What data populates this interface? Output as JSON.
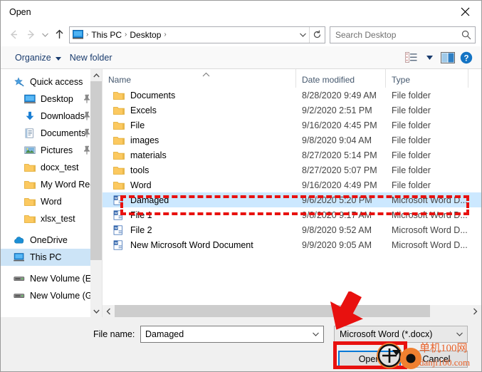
{
  "window": {
    "title": "Open",
    "close_icon": "close-icon"
  },
  "navigation": {
    "back_icon": "back-arrow-icon",
    "forward_icon": "forward-arrow-icon",
    "recent_icon": "recent-locations-chevron-icon",
    "up_icon": "up-arrow-icon",
    "address_icon": "this-pc-icon",
    "breadcrumbs": [
      "This PC",
      "Desktop"
    ],
    "separator": "›",
    "address_dropdown_icon": "chevron-down-icon",
    "refresh_icon": "refresh-icon"
  },
  "search": {
    "placeholder": "Search Desktop",
    "icon": "search-icon"
  },
  "command_bar": {
    "organize_label": "Organize",
    "organize_caret_icon": "caret-down-icon",
    "new_folder_label": "New folder",
    "view_icon": "view-options-icon",
    "view_caret_icon": "caret-down-icon",
    "preview_pane_icon": "preview-pane-icon",
    "help_icon": "help-icon"
  },
  "sidebar": {
    "items": [
      {
        "label": "Quick access",
        "icon": "quick-access-star-icon",
        "level": 0,
        "pinned": false,
        "selected": false
      },
      {
        "label": "Desktop",
        "icon": "desktop-monitor-icon",
        "level": 1,
        "pinned": true,
        "selected": false
      },
      {
        "label": "Downloads",
        "icon": "downloads-arrow-icon",
        "level": 1,
        "pinned": true,
        "selected": false
      },
      {
        "label": "Documents",
        "icon": "documents-icon",
        "level": 1,
        "pinned": true,
        "selected": false
      },
      {
        "label": "Pictures",
        "icon": "pictures-icon",
        "level": 1,
        "pinned": true,
        "selected": false
      },
      {
        "label": "docx_test",
        "icon": "folder-icon",
        "level": 1,
        "pinned": false,
        "selected": false
      },
      {
        "label": "My Word Recov",
        "icon": "folder-icon",
        "level": 1,
        "pinned": false,
        "selected": false
      },
      {
        "label": "Word",
        "icon": "folder-icon",
        "level": 1,
        "pinned": false,
        "selected": false
      },
      {
        "label": "xlsx_test",
        "icon": "folder-icon",
        "level": 1,
        "pinned": false,
        "selected": false
      },
      {
        "label": "OneDrive",
        "icon": "onedrive-cloud-icon",
        "level": 0,
        "pinned": false,
        "selected": false
      },
      {
        "label": "This PC",
        "icon": "this-pc-icon",
        "level": 0,
        "pinned": false,
        "selected": true
      },
      {
        "label": "New Volume (E:)",
        "icon": "drive-icon",
        "level": 0,
        "pinned": false,
        "selected": false
      },
      {
        "label": "New Volume (G:)",
        "icon": "drive-icon",
        "level": 0,
        "pinned": false,
        "selected": false
      }
    ],
    "scroll_up_icon": "scroll-up-icon",
    "scroll_down_icon": "scroll-down-icon"
  },
  "file_list": {
    "columns": [
      "Name",
      "Date modified",
      "Type"
    ],
    "sort_column": "Name",
    "sort_caret_icon": "sort-ascending-icon",
    "rows": [
      {
        "name": "Documents",
        "date": "8/28/2020 9:49 AM",
        "type": "File folder",
        "icon": "folder-icon",
        "selected": false
      },
      {
        "name": "Excels",
        "date": "9/2/2020 2:51 PM",
        "type": "File folder",
        "icon": "folder-icon",
        "selected": false
      },
      {
        "name": "File",
        "date": "9/16/2020 4:45 PM",
        "type": "File folder",
        "icon": "folder-icon",
        "selected": false
      },
      {
        "name": "images",
        "date": "9/8/2020 9:04 AM",
        "type": "File folder",
        "icon": "folder-icon",
        "selected": false
      },
      {
        "name": "materials",
        "date": "8/27/2020 5:14 PM",
        "type": "File folder",
        "icon": "folder-icon",
        "selected": false
      },
      {
        "name": "tools",
        "date": "8/27/2020 5:07 PM",
        "type": "File folder",
        "icon": "folder-icon",
        "selected": false
      },
      {
        "name": "Word",
        "date": "9/16/2020 4:49 PM",
        "type": "File folder",
        "icon": "folder-icon",
        "selected": false
      },
      {
        "name": "Damaged",
        "date": "9/6/2020 5:20 PM",
        "type": "Microsoft Word D...",
        "icon": "word-document-icon",
        "selected": true
      },
      {
        "name": "File 1",
        "date": "9/8/2020 9:17 AM",
        "type": "Microsoft Word D...",
        "icon": "word-document-icon",
        "selected": false
      },
      {
        "name": "File 2",
        "date": "9/8/2020 9:52 AM",
        "type": "Microsoft Word D...",
        "icon": "word-document-icon",
        "selected": false
      },
      {
        "name": "New Microsoft Word Document",
        "date": "9/9/2020 9:05 AM",
        "type": "Microsoft Word D...",
        "icon": "word-document-icon",
        "selected": false
      }
    ],
    "hscroll_left_icon": "scroll-left-icon",
    "hscroll_right_icon": "scroll-right-icon"
  },
  "footer": {
    "file_name_label": "File name:",
    "file_name_value": "Damaged",
    "file_name_dropdown_icon": "chevron-down-icon",
    "file_type_value": "Microsoft Word (*.docx)",
    "file_type_dropdown_icon": "chevron-down-icon",
    "open_label": "Open",
    "cancel_label": "Cancel"
  },
  "annotations": {
    "selection_highlight_color": "#e8110f",
    "open_button_highlight_color": "#e8110f",
    "arrow_color": "#e8110f",
    "cursor_icon": "crosshair-cursor-icon",
    "click_marker_icon": "click-marker-icon"
  },
  "watermark": {
    "line1": "单机100网",
    "line2": "danji100.com",
    "color": "#e8622a"
  }
}
